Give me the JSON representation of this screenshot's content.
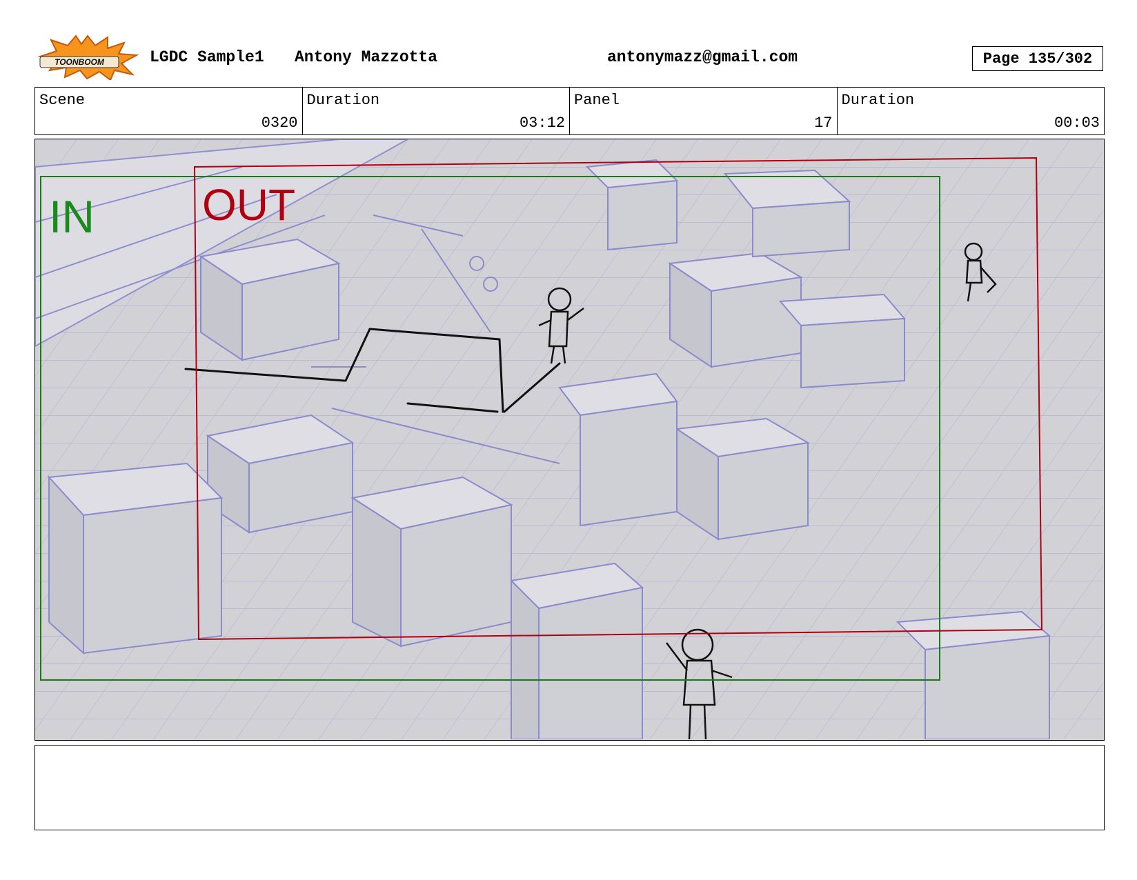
{
  "header": {
    "logo_text": "TOONBOOM",
    "project": "LGDC Sample1",
    "author": "Antony Mazzotta",
    "email": "antonymazz@gmail.com",
    "page": "Page 135/302"
  },
  "info": {
    "scene_label": "Scene",
    "scene_value": "0320",
    "scene_duration_label": "Duration",
    "scene_duration_value": "03:12",
    "panel_label": "Panel",
    "panel_value": "17",
    "panel_duration_label": "Duration",
    "panel_duration_value": "00:03"
  },
  "panel": {
    "in_label": "IN",
    "out_label": "OUT",
    "in_color": "#1a8a1a",
    "out_color": "#b00010",
    "sketch_color": "#8f8fd0"
  },
  "notes": {
    "text": ""
  }
}
